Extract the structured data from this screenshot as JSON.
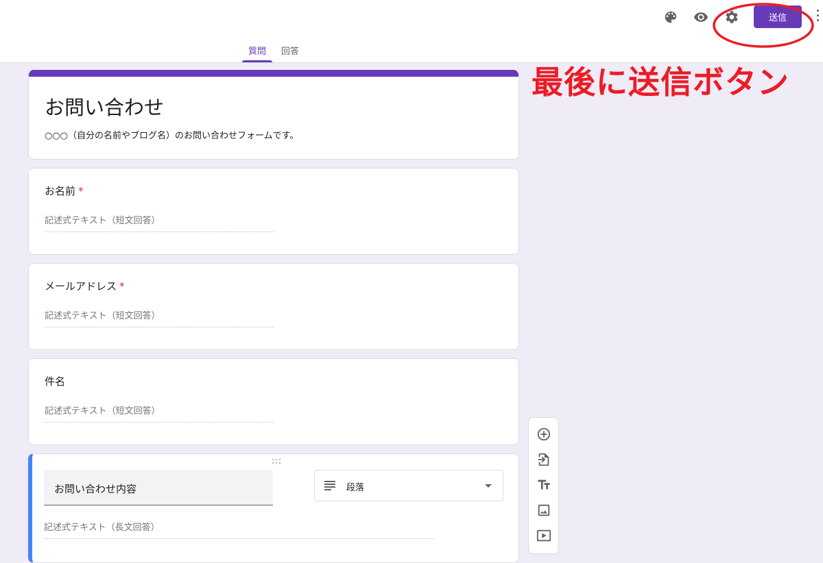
{
  "header": {
    "send_label": "送信",
    "tabs": [
      {
        "label": "質問",
        "active": true
      },
      {
        "label": "回答",
        "active": false
      }
    ],
    "icons": [
      "palette-icon",
      "eye-icon",
      "gear-icon",
      "more-vert-icon"
    ]
  },
  "annotation": {
    "text": "最後に送信ボタン",
    "color": "#ec1c24"
  },
  "form": {
    "title": "お問い合わせ",
    "description": "○○○（自分の名前やブログ名）のお問い合わせフォームです。",
    "accent_color": "#673ab7",
    "questions": [
      {
        "title": "お名前",
        "required_mark": "*",
        "hint": "記述式テキスト（短文回答）"
      },
      {
        "title": "メールアドレス",
        "required_mark": "*",
        "hint": "記述式テキスト（短文回答）"
      },
      {
        "title": "件名",
        "required_mark": "",
        "hint": "記述式テキスト（短文回答）"
      }
    ],
    "active_question": {
      "title": "お問い合わせ内容",
      "type_label": "段落",
      "hint": "記述式テキスト（長文回答）"
    }
  },
  "side_toolbar": [
    "add-question-icon",
    "import-questions-icon",
    "add-title-icon",
    "add-image-icon",
    "add-video-icon"
  ]
}
